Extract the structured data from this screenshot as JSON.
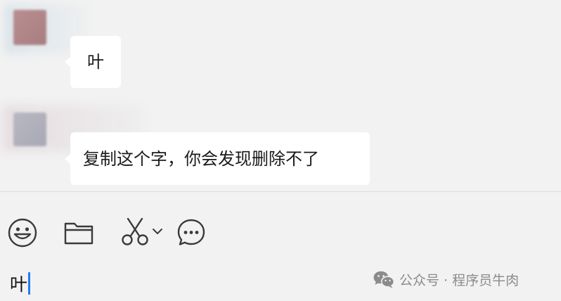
{
  "chat": {
    "messages": [
      {
        "sender": "contact",
        "text": "叶"
      },
      {
        "sender": "contact",
        "text": "复制这个字，你会发现删除不了"
      }
    ]
  },
  "toolbar": {
    "icons": [
      "emoji-icon",
      "folder-icon",
      "scissors-icon",
      "chevron-down-icon",
      "chat-bubble-icon"
    ]
  },
  "compose": {
    "value": "叶"
  },
  "watermark": {
    "text": "公众号 · 程序员牛肉"
  },
  "colors": {
    "background": "#f2f2f2",
    "bubble": "#ffffff",
    "caret": "#1f7cf0",
    "icon": "#3a3a3a"
  }
}
